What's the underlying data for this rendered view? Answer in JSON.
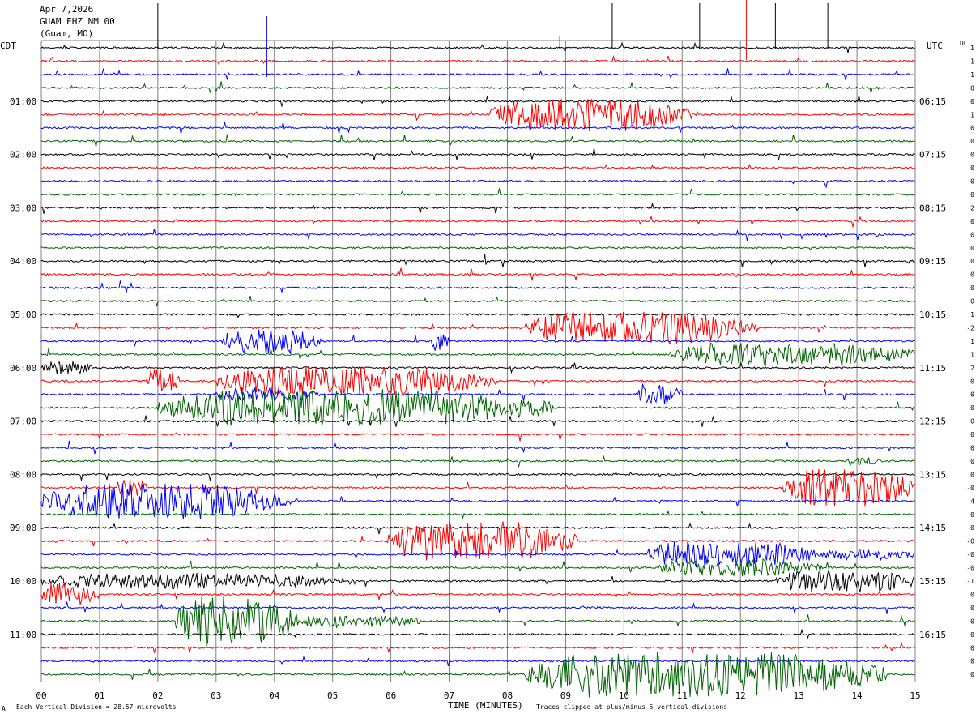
{
  "header": {
    "date": "Apr 7,2026",
    "station": "GUAM EHZ NM 00",
    "location": "(Guam, MO)"
  },
  "left_zone": "CDT",
  "right_zone": "UTC",
  "dc_label": "DC",
  "footer": {
    "corner_mark": "A",
    "scale_note": "Each Vertical Division =   28.57 microvolts",
    "clip_note": "Traces clipped at plus/minus 5 vertical divisions"
  },
  "colors": {
    "black": "#000000",
    "red": "#ff0000",
    "blue": "#0000ff",
    "green": "#006400",
    "grid": "#808080"
  },
  "chart_data": {
    "type": "helicorder",
    "xlabel": "TIME (MINUTES)",
    "xlim": [
      0,
      15
    ],
    "x_ticks": [
      "00",
      "01",
      "02",
      "03",
      "04",
      "05",
      "06",
      "07",
      "08",
      "09",
      "10",
      "11",
      "12",
      "13",
      "14",
      "15"
    ],
    "trace_count": 48,
    "trace_color_cycle": [
      "black",
      "red",
      "blue",
      "green"
    ],
    "left_hour_labels": [
      "01:00",
      "02:00",
      "03:00",
      "04:00",
      "05:00",
      "06:00",
      "07:00",
      "08:00",
      "09:00",
      "10:00",
      "11:00"
    ],
    "left_hour_label_traces": [
      4,
      8,
      12,
      16,
      20,
      24,
      28,
      32,
      36,
      40,
      44
    ],
    "right_hour_labels": [
      "06:15",
      "07:15",
      "08:15",
      "09:15",
      "10:15",
      "11:15",
      "12:15",
      "13:15",
      "14:15",
      "15:15",
      "16:15"
    ],
    "right_hour_label_traces": [
      4,
      8,
      12,
      16,
      20,
      24,
      28,
      32,
      36,
      40,
      44
    ],
    "dc_offsets": [
      "1",
      "1",
      "1",
      "0",
      "0",
      "1",
      "0",
      "0",
      "0",
      "0",
      "0",
      "0",
      "2",
      "0",
      "0",
      "0",
      "0",
      "0",
      "0",
      "0",
      "1",
      "-2",
      "1",
      "1",
      "2",
      "0",
      "-0",
      "0",
      "0",
      "0",
      "0",
      "0",
      "0",
      "-0",
      "-4",
      "0",
      "-0",
      "-0",
      "-0",
      "-0",
      "-1",
      "0",
      "0",
      "0",
      "0",
      "0",
      "0",
      "0"
    ],
    "events": [
      {
        "trace": 5,
        "start": 7.7,
        "end": 11.2,
        "amp": 20
      },
      {
        "trace": 25,
        "start": 1.8,
        "end": 2.4,
        "amp": 16
      },
      {
        "trace": 25,
        "start": 3.0,
        "end": 7.8,
        "amp": 18
      },
      {
        "trace": 21,
        "start": 8.3,
        "end": 12.3,
        "amp": 20
      },
      {
        "trace": 26,
        "start": 3.0,
        "end": 4.8,
        "amp": 8
      },
      {
        "trace": 26,
        "start": 10.2,
        "end": 11.0,
        "amp": 12
      },
      {
        "trace": 27,
        "start": 2.0,
        "end": 8.8,
        "amp": 22
      },
      {
        "trace": 22,
        "start": 3.1,
        "end": 4.8,
        "amp": 16
      },
      {
        "trace": 22,
        "start": 6.7,
        "end": 7.0,
        "amp": 12
      },
      {
        "trace": 23,
        "start": 10.8,
        "end": 15.0,
        "amp": 14
      },
      {
        "trace": 24,
        "start": 0.0,
        "end": 0.9,
        "amp": 8
      },
      {
        "trace": 33,
        "start": 1.3,
        "end": 1.8,
        "amp": 14
      },
      {
        "trace": 33,
        "start": 12.7,
        "end": 15.0,
        "amp": 24
      },
      {
        "trace": 34,
        "start": 0.0,
        "end": 4.2,
        "amp": 22
      },
      {
        "trace": 37,
        "start": 5.9,
        "end": 9.2,
        "amp": 24
      },
      {
        "trace": 38,
        "start": 10.4,
        "end": 13.3,
        "amp": 16
      },
      {
        "trace": 38,
        "start": 13.3,
        "end": 15.0,
        "amp": 6
      },
      {
        "trace": 39,
        "start": 10.6,
        "end": 13.4,
        "amp": 10
      },
      {
        "trace": 40,
        "start": 0.0,
        "end": 5.4,
        "amp": 9
      },
      {
        "trace": 40,
        "start": 12.6,
        "end": 15.0,
        "amp": 14
      },
      {
        "trace": 41,
        "start": 0.0,
        "end": 1.0,
        "amp": 14
      },
      {
        "trace": 43,
        "start": 2.3,
        "end": 4.4,
        "amp": 30
      },
      {
        "trace": 43,
        "start": 4.4,
        "end": 6.5,
        "amp": 8
      },
      {
        "trace": 47,
        "start": 8.3,
        "end": 14.5,
        "amp": 28
      },
      {
        "trace": 31,
        "start": 13.8,
        "end": 14.4,
        "amp": 5
      }
    ]
  }
}
